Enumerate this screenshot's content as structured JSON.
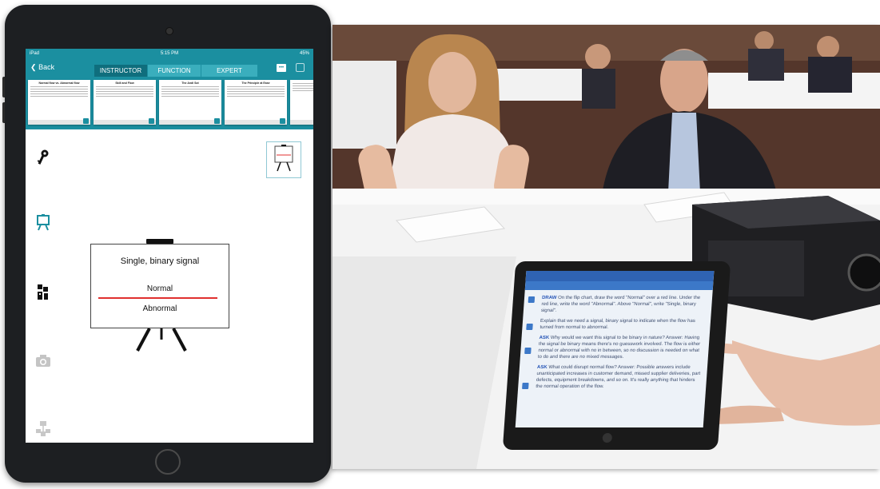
{
  "ipad": {
    "status": {
      "carrier": "iPad",
      "time": "5:15 PM",
      "battery": "45%"
    },
    "nav": {
      "back_label": "Back",
      "more_label": "•••"
    },
    "tabs": [
      {
        "label": "INSTRUCTOR",
        "active": true
      },
      {
        "label": "FUNCTION",
        "active": false
      },
      {
        "label": "EXPERT",
        "active": false
      }
    ],
    "thumbnails": [
      {
        "title": "Normal flow vs. Abnormal flow"
      },
      {
        "title": "Skill and Flow"
      },
      {
        "title": "The Andi Sot"
      },
      {
        "title": "The Principle at Ease"
      },
      {
        "title": ""
      }
    ],
    "sidebar_icons": [
      "key-icon",
      "easel-icon",
      "team-icon",
      "camera-icon",
      "org-chart-icon"
    ],
    "slide": {
      "title": "Single, binary signal",
      "normal_label": "Normal",
      "abnormal_label": "Abnormal"
    }
  },
  "photo": {
    "description_tags": [
      "woman-seated",
      "man-seated",
      "projector",
      "pointing-hand"
    ],
    "tablet": {
      "paragraphs": [
        {
          "keyword": "DRAW",
          "text": "On the flip chart, draw the word \"Normal\" over a red line. Under the red line, write the word \"Abnormal\". Above \"Normal\", write \"Single, binary signal\"."
        },
        {
          "keyword": "",
          "text": "Explain that we need a signal, binary signal to indicate when the flow has turned from normal to abnormal."
        },
        {
          "keyword": "ASK",
          "text": "Why would we want this signal to be binary in nature? Answer: Having the signal be binary means there's no guesswork involved. The flow is either normal or abnormal with no in between, so no discussion is needed on what to do and there are no mixed messages."
        },
        {
          "keyword": "ASK",
          "text": "What could disrupt normal flow? Answer: Possible answers include unanticipated increases in customer demand, missed supplier deliveries, part defects, equipment breakdowns, and so on. It's really anything that hinders the normal operation of the flow."
        }
      ]
    }
  },
  "colors": {
    "teal": "#1b8fa0",
    "teal_dark": "#0f6e7d",
    "red_line": "#e0302f",
    "tablet_blue": "#2f63b3"
  }
}
